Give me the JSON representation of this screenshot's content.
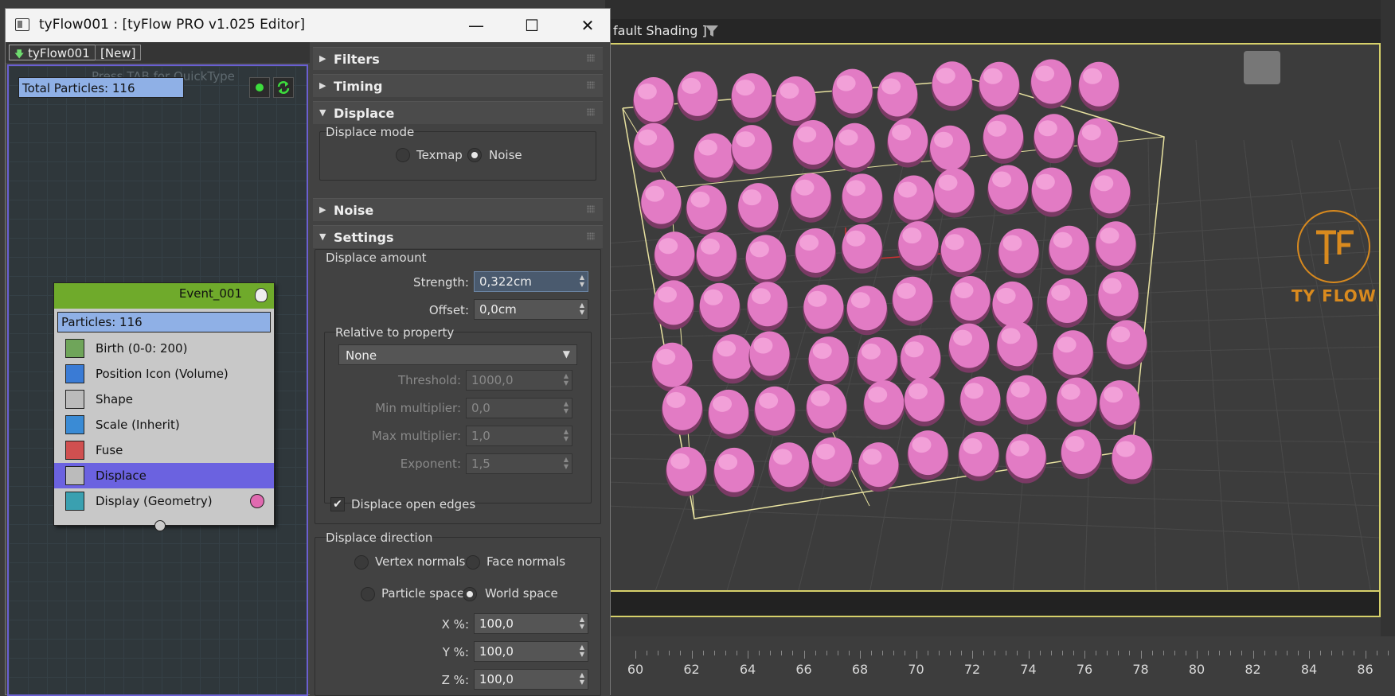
{
  "viewport": {
    "header_label": "fault Shading ]",
    "logo_text": "TY FLOW",
    "timeline_ticks": [
      "60",
      "62",
      "64",
      "66",
      "68",
      "70",
      "72",
      "74",
      "76",
      "78",
      "80",
      "82",
      "84",
      "86"
    ]
  },
  "window": {
    "title": "tyFlow001 : [tyFlow PRO v1.025 Editor]",
    "minimize": "—",
    "maximize": "☐",
    "close": "✕"
  },
  "flow": {
    "tab_name": "tyFlow001",
    "tab_new": "[New]",
    "quicktype_hint": "Press TAB for QuickType",
    "total_particles": "Total Particles: 116",
    "event": {
      "name": "Event_001",
      "particles": "Particles: 116",
      "operators": [
        {
          "label": "Birth (0-0: 200)",
          "icon": "birth-icon"
        },
        {
          "label": "Position Icon (Volume)",
          "icon": "position-icon"
        },
        {
          "label": "Shape",
          "icon": "shape-icon"
        },
        {
          "label": "Scale (Inherit)",
          "icon": "scale-icon"
        },
        {
          "label": "Fuse",
          "icon": "fuse-icon"
        },
        {
          "label": "Displace",
          "icon": "displace-icon",
          "selected": true
        },
        {
          "label": "Display (Geometry)",
          "icon": "display-icon"
        }
      ]
    }
  },
  "props": {
    "rollouts": {
      "filters": "Filters",
      "timing": "Timing",
      "displace": "Displace",
      "noise": "Noise",
      "settings": "Settings"
    },
    "displace_mode": {
      "label": "Displace mode",
      "texmap": "Texmap",
      "noise": "Noise",
      "selected": "Noise"
    },
    "settings": {
      "displace_amount": "Displace amount",
      "strength_label": "Strength:",
      "strength_value": "0,322cm",
      "offset_label": "Offset:",
      "offset_value": "0,0cm",
      "relative_label": "Relative to property",
      "relative_value": "None",
      "threshold_label": "Threshold:",
      "threshold_value": "1000,0",
      "min_mult_label": "Min multiplier:",
      "min_mult_value": "0,0",
      "max_mult_label": "Max multiplier:",
      "max_mult_value": "1,0",
      "exponent_label": "Exponent:",
      "exponent_value": "1,5",
      "open_edges_label": "Displace open edges",
      "open_edges_checked": true
    },
    "direction": {
      "label": "Displace direction",
      "vertex_normals": "Vertex normals",
      "face_normals": "Face normals",
      "particle_space": "Particle space",
      "world_space": "World space",
      "x_label": "X %:",
      "x_value": "100,0",
      "y_label": "Y %:",
      "y_value": "100,0",
      "z_label": "Z %:",
      "z_value": "100,0"
    }
  }
}
